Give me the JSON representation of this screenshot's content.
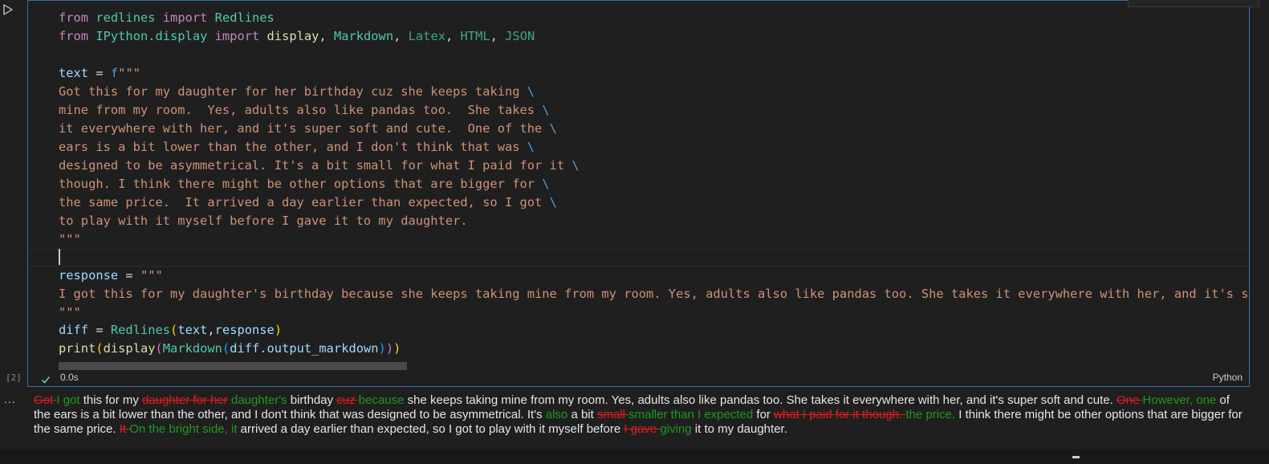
{
  "code": {
    "line1": {
      "kw_from": "from",
      "module": "redlines",
      "kw_import": "import",
      "name": "Redlines"
    },
    "line2": {
      "kw_from": "from",
      "module": "IPython.display",
      "kw_import": "import",
      "n1": "display",
      "n2": "Markdown",
      "n3": "Latex",
      "n4": "HTML",
      "n5": "JSON",
      "sep": ", "
    },
    "text_var": "text",
    "assign": " = ",
    "fprefix": "f",
    "triple_quote": "\"\"\"",
    "backslash": "\\",
    "text_lines": [
      "Got this for my daughter for her birthday cuz she keeps taking ",
      "mine from my room.  Yes, adults also like pandas too.  She takes ",
      "it everywhere with her, and it's super soft and cute.  One of the ",
      "ears is a bit lower than the other, and I don't think that was ",
      "designed to be asymmetrical. It's a bit small for what I paid for it ",
      "though. I think there might be other options that are bigger for ",
      "the same price.  It arrived a day earlier than expected, so I got ",
      "to play with it myself before I gave it to my daughter."
    ],
    "response_var": "response",
    "response_line": "I got this for my daughter's birthday because she keeps taking mine from my room. Yes, adults also like pandas too. She takes it everywhere with her, and it's su",
    "diff_var": "diff",
    "redlines_class": "Redlines",
    "arg_text": "text",
    "arg_comma": ",",
    "arg_response": "response",
    "print_fn": "print",
    "display_fn": "display",
    "markdown_cls": "Markdown",
    "diff_attr": "diff.output_markdown"
  },
  "status": {
    "exec_count": "[2]",
    "time": "0.0s",
    "language": "Python"
  },
  "output": {
    "menu": "...",
    "segments": [
      {
        "t": "del",
        "v": "Got "
      },
      {
        "t": "ins",
        "v": "I got"
      },
      {
        "t": "txt",
        "v": " this for my "
      },
      {
        "t": "del",
        "v": "daughter for her"
      },
      {
        "t": "ins",
        "v": " daughter's"
      },
      {
        "t": "txt",
        "v": " birthday "
      },
      {
        "t": "del",
        "v": "cuz "
      },
      {
        "t": "ins",
        "v": "because"
      },
      {
        "t": "txt",
        "v": " she keeps taking mine from my room. Yes, adults also like pandas too. She takes it everywhere with her, and it's super soft and cute. "
      },
      {
        "t": "del",
        "v": "One "
      },
      {
        "t": "ins",
        "v": "However, one"
      },
      {
        "t": "txt",
        "v": " of the ears is a bit lower than the other, and I don't think that was designed to be asymmetrical. It's "
      },
      {
        "t": "ins",
        "v": "also"
      },
      {
        "t": "txt",
        "v": " a bit "
      },
      {
        "t": "del",
        "v": "small "
      },
      {
        "t": "ins",
        "v": "smaller than I expected"
      },
      {
        "t": "txt",
        "v": " for "
      },
      {
        "t": "del",
        "v": "what I paid for it though. "
      },
      {
        "t": "ins",
        "v": "the price."
      },
      {
        "t": "txt",
        "v": " I think there might be other options that are bigger for the same price. "
      },
      {
        "t": "del",
        "v": "It "
      },
      {
        "t": "ins",
        "v": "On the bright side, it"
      },
      {
        "t": "txt",
        "v": " arrived a day earlier than expected, so I got to play with it myself before "
      },
      {
        "t": "del",
        "v": "I gave "
      },
      {
        "t": "ins",
        "v": "giving"
      },
      {
        "t": "txt",
        "v": " it to my daughter."
      }
    ]
  },
  "colors": {
    "cell_border": "#2f6fb8",
    "deleted": "#e01e1e",
    "inserted": "#1e9a1e",
    "string": "#ce9178",
    "keyword": "#c586c0"
  }
}
